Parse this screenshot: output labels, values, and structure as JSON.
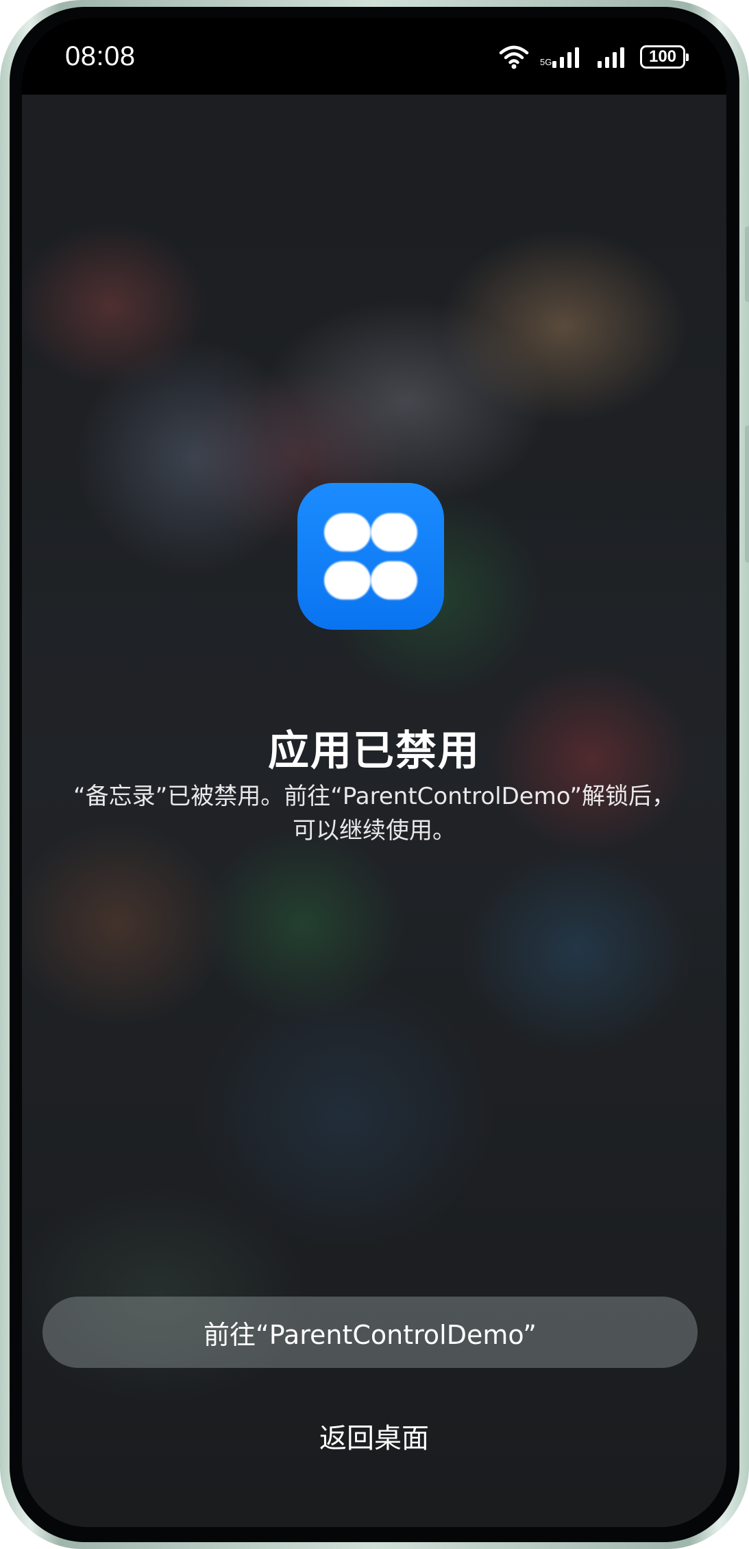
{
  "status_bar": {
    "time": "08:08",
    "battery": "100",
    "icons": [
      "wifi-icon",
      "signal-icon",
      "signal-icon",
      "battery-icon"
    ]
  },
  "app": {
    "icon": "four-petal-app-icon",
    "icon_color": "#0A7CF5"
  },
  "dialog": {
    "title": "应用已禁用",
    "message": "“备忘录”已被禁用。前往“ParentControlDemo”解锁后，可以继续使用。"
  },
  "actions": {
    "primary_label": "前往“ParentControlDemo”",
    "secondary_label": "返回桌面"
  }
}
